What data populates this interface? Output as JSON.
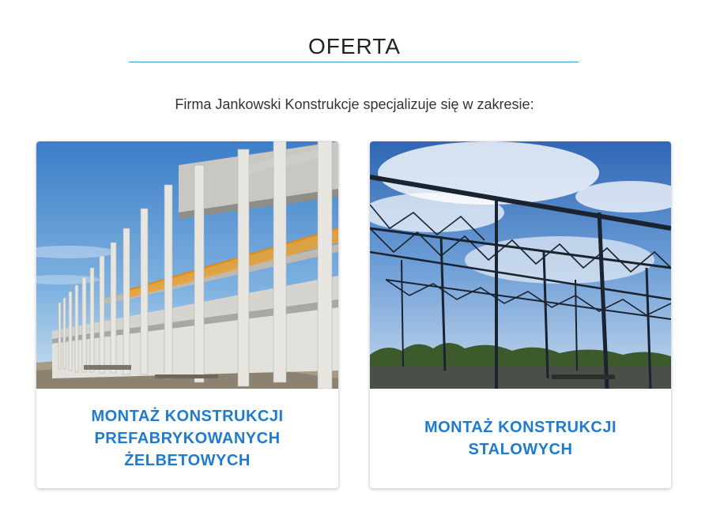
{
  "section": {
    "title": "OFERTA",
    "intro": "Firma Jankowski Konstrukcje specjalizuje się w zakresie:"
  },
  "cards": [
    {
      "title": "MONTAŻ KONSTRUKCJI\nPREFABRYKOWANYCH\nŻELBETOWYCH",
      "image": "precast-concrete-structure-photo"
    },
    {
      "title": "MONTAŻ KONSTRUKCJI\nSTALOWYCH",
      "image": "steel-truss-structure-photo"
    }
  ],
  "colors": {
    "accent_line": "#2a9bc4",
    "card_title": "#1e7bd0",
    "heading": "#222222"
  }
}
